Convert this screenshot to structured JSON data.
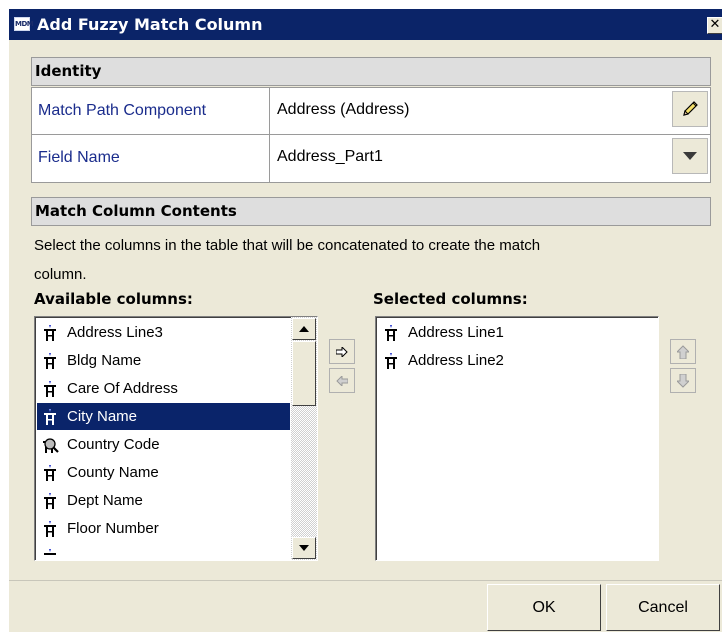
{
  "window": {
    "app_icon_text": "MDM",
    "title": "Add Fuzzy Match Column",
    "close_glyph": "✕"
  },
  "identity": {
    "header": "Identity",
    "rows": [
      {
        "label": "Match Path Component",
        "value": "Address (Address)",
        "action_icon": "pencil-icon"
      },
      {
        "label": "Field Name",
        "value": "Address_Part1",
        "action_icon": "chevron-down-icon"
      }
    ]
  },
  "contents": {
    "header": "Match Column Contents",
    "description_line1": "Select the columns in the table that will be concatenated to create the match",
    "description_line2": "column."
  },
  "available": {
    "label": "Available columns:",
    "items": [
      {
        "label": "Address Line3",
        "icon": "column-icon"
      },
      {
        "label": "Bldg Name",
        "icon": "column-icon"
      },
      {
        "label": "Care Of Address",
        "icon": "column-icon"
      },
      {
        "label": "City Name",
        "icon": "column-icon",
        "selected": true
      },
      {
        "label": "Country Code",
        "icon": "lookup-column-icon"
      },
      {
        "label": "County Name",
        "icon": "column-icon"
      },
      {
        "label": "Dept Name",
        "icon": "column-icon"
      },
      {
        "label": "Floor Number",
        "icon": "column-icon"
      }
    ]
  },
  "selected": {
    "label": "Selected columns:",
    "items": [
      {
        "label": "Address Line1",
        "icon": "column-icon"
      },
      {
        "label": "Address Line2",
        "icon": "column-icon"
      }
    ]
  },
  "buttons": {
    "ok": "OK",
    "cancel": "Cancel"
  },
  "colors": {
    "title_bar": "#0b2468",
    "dialog_bg": "#ece9d8",
    "selection": "#0a246a",
    "label_text": "#1a2c8c"
  }
}
